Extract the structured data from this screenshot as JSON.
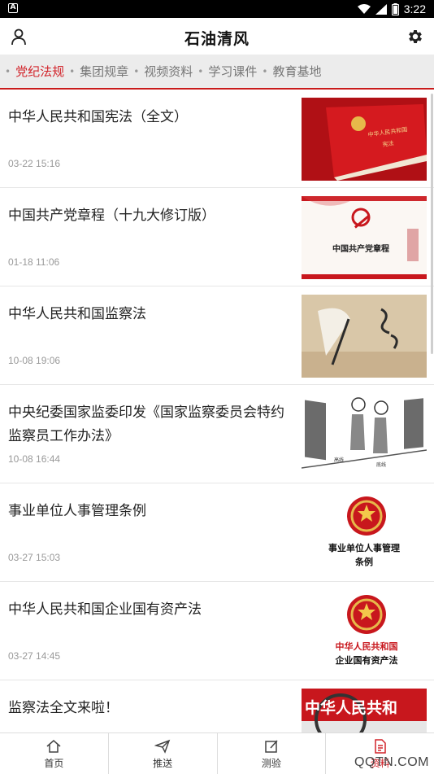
{
  "status": {
    "time": "3:22",
    "notif": "A"
  },
  "app": {
    "title": "石油清风"
  },
  "tabs": [
    {
      "label": "党纪法规",
      "active": true
    },
    {
      "label": "集团规章",
      "active": false
    },
    {
      "label": "视频资料",
      "active": false
    },
    {
      "label": "学习课件",
      "active": false
    },
    {
      "label": "教育基地",
      "active": false
    }
  ],
  "articles": [
    {
      "title": "中华人民共和国宪法（全文）",
      "time": "03-22 15:16",
      "thumb": "red-book-constitution",
      "thumb_text": [
        "中华人民共和国",
        "宪法"
      ]
    },
    {
      "title": "中国共产党章程（十九大修订版）",
      "time": "01-18 11:06",
      "thumb": "party-charter",
      "thumb_text": [
        "中国共产党章程"
      ]
    },
    {
      "title": "中华人民共和国监察法",
      "time": "10-08 19:06",
      "thumb": "pen-calligraphy",
      "thumb_text": []
    },
    {
      "title": "中央纪委国家监委印发《国家监察委员会特约监察员工作办法》",
      "time": "10-08 16:44",
      "thumb": "cartoon-supervision",
      "thumb_text": [
        "高线",
        "底线"
      ]
    },
    {
      "title": "事业单位人事管理条例",
      "time": "03-27 15:03",
      "thumb": "national-emblem",
      "thumb_text": [
        "事业单位人事管理",
        "条例"
      ]
    },
    {
      "title": "中华人民共和国企业国有资产法",
      "time": "03-27 14:45",
      "thumb": "national-emblem-red",
      "thumb_text": [
        "中华人民共和国",
        "企业国有资产法"
      ]
    },
    {
      "title": "监察法全文来啦！",
      "time": "",
      "thumb": "magnifier-red",
      "thumb_text": [
        "中华人民共和"
      ]
    }
  ],
  "bottom_nav": [
    {
      "label": "首页",
      "icon": "home-icon"
    },
    {
      "label": "推送",
      "icon": "send-icon"
    },
    {
      "label": "测验",
      "icon": "edit-icon"
    },
    {
      "label": "资料",
      "icon": "document-icon"
    }
  ],
  "watermark": "QQTN.COM",
  "colors": {
    "accent": "#d2232a",
    "tabbar_bg": "#ececec",
    "statusbar": "#000000"
  }
}
